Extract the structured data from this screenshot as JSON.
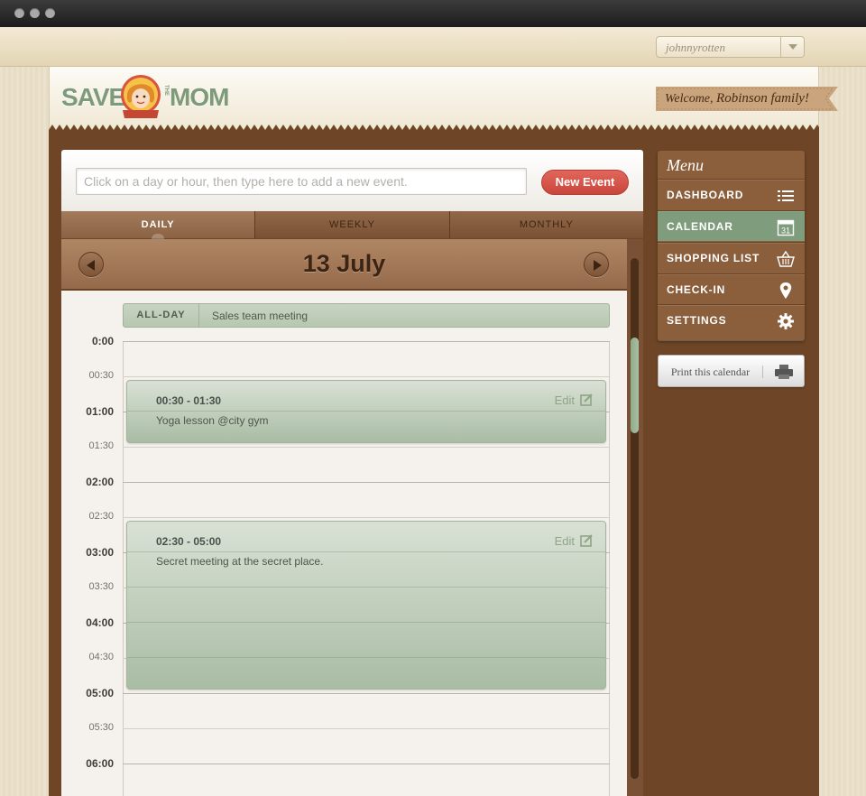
{
  "user": {
    "name": "johnnyrotten"
  },
  "logo": {
    "left": "SAVE",
    "middle": "THE",
    "right": "MOM",
    "badge": "SINCE 2011"
  },
  "welcome": {
    "prefix": "Welcome,",
    "name": "Robinson family!"
  },
  "event_input": {
    "placeholder": "Click on a day or hour, then type here to add a new event."
  },
  "new_event_label": "New Event",
  "tabs": [
    {
      "label": "DAILY",
      "active": true
    },
    {
      "label": "WEEKLY",
      "active": false
    },
    {
      "label": "MONTHLY",
      "active": false
    }
  ],
  "date_title": "13 July",
  "all_day": {
    "label": "ALL-DAY",
    "event": "Sales team meeting"
  },
  "times": [
    "0:00",
    "00:30",
    "01:00",
    "01:30",
    "02:00",
    "02:30",
    "03:00",
    "03:30",
    "04:00",
    "04:30",
    "05:00",
    "05:30",
    "06:00"
  ],
  "events": [
    {
      "time": "00:30 - 01:30",
      "title": "Yoga lesson @city gym",
      "edit": "Edit"
    },
    {
      "time": "02:30 - 05:00",
      "title": "Secret meeting at the secret place.",
      "edit": "Edit"
    }
  ],
  "menu": {
    "title": "Menu",
    "items": [
      {
        "label": "DASHBOARD",
        "icon": "list-icon",
        "active": false
      },
      {
        "label": "CALENDAR",
        "icon": "calendar-icon",
        "icon_text": "31",
        "active": true
      },
      {
        "label": "SHOPPING LIST",
        "icon": "basket-icon",
        "active": false
      },
      {
        "label": "CHECK-IN",
        "icon": "location-pin-icon",
        "active": false
      },
      {
        "label": "SETTINGS",
        "icon": "gear-icon",
        "active": false
      }
    ]
  },
  "print_label": "Print this calendar",
  "colors": {
    "brown": "#6e4526",
    "green": "#7f9c7c",
    "red": "#d2544a",
    "cream": "#ece3cf"
  }
}
